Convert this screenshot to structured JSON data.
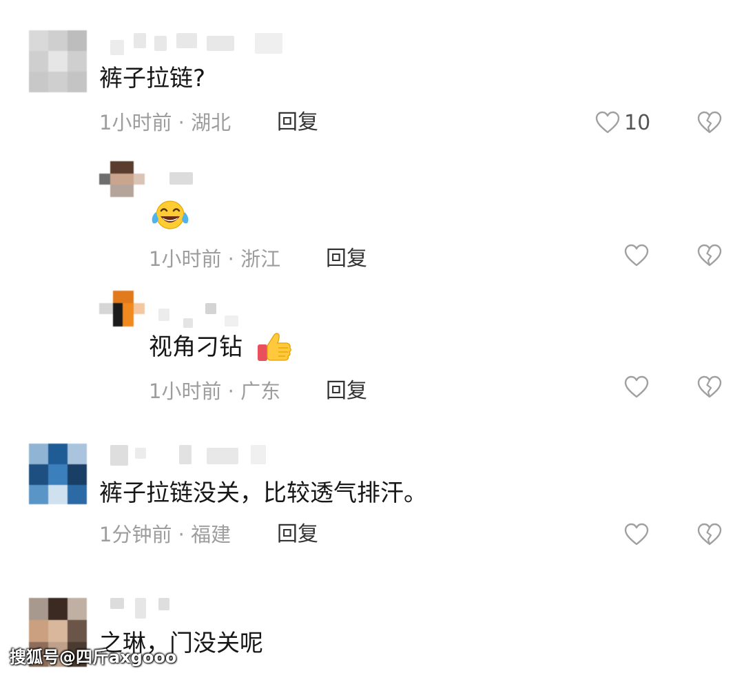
{
  "comments": [
    {
      "content": "裤子拉链?",
      "time": "1小时前",
      "location": "湖北",
      "reply_label": "回复",
      "like_count": "10"
    },
    {
      "content": "",
      "time": "1小时前",
      "location": "浙江",
      "reply_label": "回复"
    },
    {
      "content": "视角刁钻",
      "time": "1小时前",
      "location": "广东",
      "reply_label": "回复"
    },
    {
      "content": "裤子拉链没关，比较透气排汗。",
      "time": "1分钟前",
      "location": "福建",
      "reply_label": "回复"
    },
    {
      "content": "之琳，门没关呢"
    }
  ],
  "separator": " · ",
  "watermark": "搜狐号@四斤axgooo",
  "icons": {
    "like": "heart-outline-icon",
    "dislike": "broken-heart-icon",
    "laugh": "tears-of-joy-emoji",
    "thumbs_up": "thumbs-up-emoji"
  },
  "colors": {
    "text": "#161616",
    "meta": "#9d9d9d",
    "icon": "#a0a0a0"
  }
}
